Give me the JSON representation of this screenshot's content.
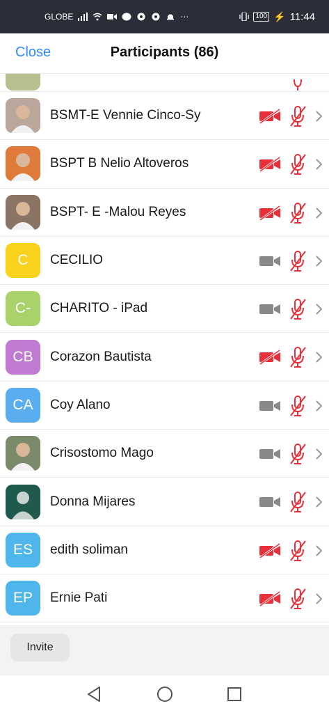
{
  "status_bar": {
    "carrier": "GLOBE",
    "battery": "100",
    "time": "11:44"
  },
  "header": {
    "close_label": "Close",
    "title": "Participants (86)"
  },
  "colors": {
    "accent": "#2d8cff",
    "muted_red": "#e8303a",
    "camera_on_gray": "#888888"
  },
  "participants": [
    {
      "name": "BSMT-E Vennie Cinco-Sy",
      "initials": "",
      "avatar_color": "#b8a79a",
      "photo": true,
      "video_muted": true,
      "audio_muted": true
    },
    {
      "name": "BSPT B Nelio Altoveros",
      "initials": "",
      "avatar_color": "#e07a3a",
      "photo": true,
      "video_muted": true,
      "audio_muted": true
    },
    {
      "name": "BSPT- E -Malou Reyes",
      "initials": "",
      "avatar_color": "#8a7565",
      "photo": true,
      "video_muted": true,
      "audio_muted": true
    },
    {
      "name": "CECILIO",
      "initials": "C",
      "avatar_color": "#f8d21c",
      "photo": false,
      "video_muted": false,
      "audio_muted": true
    },
    {
      "name": "CHARITO - iPad",
      "initials": "C-",
      "avatar_color": "#a9d26b",
      "photo": false,
      "video_muted": false,
      "audio_muted": true
    },
    {
      "name": "Corazon Bautista",
      "initials": "CB",
      "avatar_color": "#c07ad1",
      "photo": false,
      "video_muted": true,
      "audio_muted": true
    },
    {
      "name": "Coy Alano",
      "initials": "CA",
      "avatar_color": "#5aaef0",
      "photo": false,
      "video_muted": false,
      "audio_muted": true
    },
    {
      "name": "Crisostomo Mago",
      "initials": "",
      "avatar_color": "#7a8a6a",
      "photo": true,
      "video_muted": false,
      "audio_muted": true
    },
    {
      "name": "Donna Mijares",
      "initials": "",
      "avatar_color": "#1f5a4d",
      "photo": false,
      "silhouette": true,
      "video_muted": false,
      "audio_muted": true
    },
    {
      "name": "edith soliman",
      "initials": "ES",
      "avatar_color": "#4fb6ec",
      "photo": false,
      "video_muted": true,
      "audio_muted": true
    },
    {
      "name": "Ernie Pati",
      "initials": "EP",
      "avatar_color": "#4fb6ec",
      "photo": false,
      "video_muted": true,
      "audio_muted": true
    }
  ],
  "footer": {
    "invite_label": "Invite"
  }
}
